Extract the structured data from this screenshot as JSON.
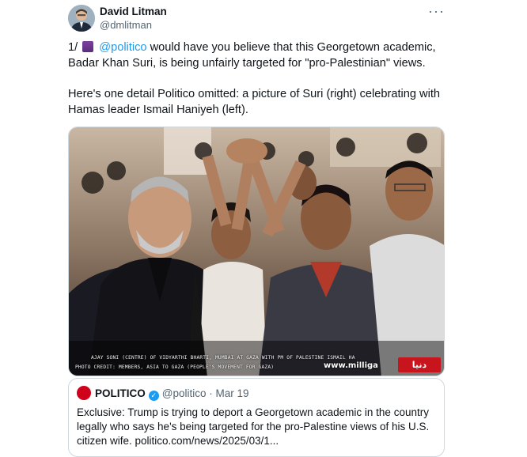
{
  "author": {
    "name": "David Litman",
    "handle": "@dmlitman"
  },
  "tweet": {
    "prefix": "1/",
    "mention": "@politico",
    "line1_rest": " would have you believe that this Georgetown academic, Badar Khan Suri, is being unfairly targeted for \"pro-Palestinian\" views.",
    "para2": "Here's one detail Politico omitted: a picture of Suri (right) celebrating with Hamas leader Ismail Haniyeh (left)."
  },
  "more_icon": "more-icon",
  "photo": {
    "caption_line1": "AJAY SONI (CENTRE) OF VIDYARTHI BHARTI, MUMBAI AT GAZA WITH PM OF PALESTINE ISMAIL HA",
    "caption_line2": "PHOTO CREDIT: MEMBERS, ASIA TO GAZA (PEOPLE'S MOVEMENT FOR GAZA)",
    "site": "www.milliga",
    "badge": "دنيا الوطن"
  },
  "quote": {
    "name": "POLITICO",
    "handle": "@politico",
    "separator": " · ",
    "date": "Mar 19",
    "text": "Exclusive: Trump is trying to deport a Georgetown academic in the country legally who says he's being targeted for the pro-Palestine views of his U.S. citizen wife. politico.com/news/2025/03/1..."
  },
  "colors": {
    "link": "#1d9bf0",
    "muted": "#536471",
    "border": "#cfd9de"
  }
}
